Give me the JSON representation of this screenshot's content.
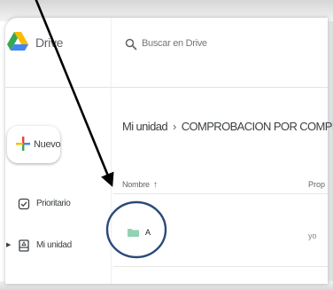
{
  "app": {
    "brand": "Drive"
  },
  "search": {
    "placeholder": "Buscar en Drive"
  },
  "sidebar": {
    "new_label": "Nuevo",
    "items": [
      {
        "label": "Prioritario",
        "icon": "check-circle-icon"
      },
      {
        "label": "Mi unidad",
        "icon": "drive-icon"
      }
    ]
  },
  "breadcrumb": {
    "root": "Mi unidad",
    "separator": "›",
    "current": "COMPROBACION POR COMPRA",
    "dropdown": "▾"
  },
  "table": {
    "columns": {
      "name": "Nombre",
      "sort_arrow": "↑",
      "owner": "Prop"
    },
    "rows": [
      {
        "name": "A",
        "owner": "yo",
        "icon": "folder-icon"
      }
    ]
  },
  "colors": {
    "drive_yellow": "#fbbc04",
    "drive_green": "#34a853",
    "drive_blue": "#4285f4",
    "folder_green": "#93d3b2",
    "annotation_circle": "#2a4a7a",
    "annotation_arrow": "#000000"
  }
}
